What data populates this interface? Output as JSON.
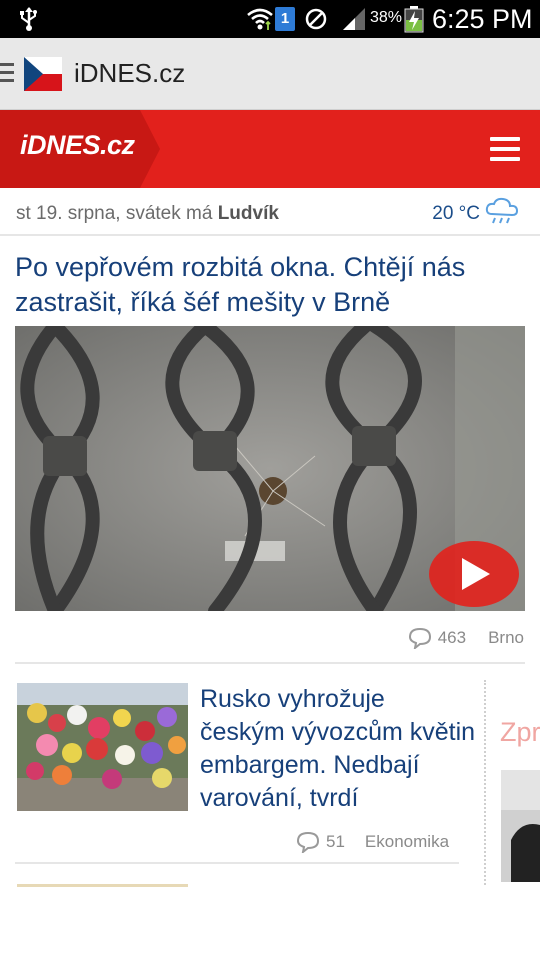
{
  "status_bar": {
    "sim_slot": "1",
    "battery_percent": "38%",
    "time": "6:25 PM"
  },
  "app_bar": {
    "title": "iDNES.cz"
  },
  "site_header": {
    "logo_text": "iDNES.cz",
    "brand_color": "#e2211c"
  },
  "date_row": {
    "date_prefix": "st 19. srpna, svátek má ",
    "nameday": "Ludvík",
    "temperature": "20 °C",
    "weather_icon": "rain-cloud-icon"
  },
  "main_article": {
    "headline": "Po vepřovém rozbitá okna. Chtějí nás zastrašit, říká šéf mešity v Brně",
    "comment_count": "463",
    "section": "Brno"
  },
  "second_article": {
    "headline": "Rusko vyhrožuje českým vývozcům květin embargem. Nedbají varování, tvrdí",
    "comment_count": "51",
    "section": "Ekonomika"
  },
  "side_teaser": {
    "text": "Zpr"
  },
  "colors": {
    "headline_blue": "#17407a",
    "meta_gray": "#8a8a8a"
  }
}
